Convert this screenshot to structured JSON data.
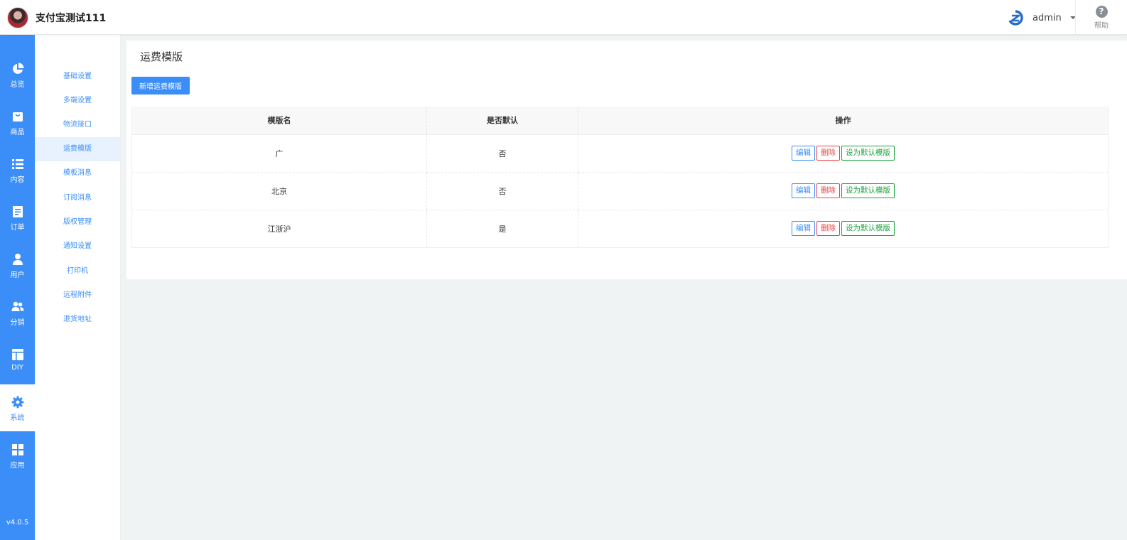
{
  "header": {
    "shop_name": "支付宝测试111",
    "username": "admin",
    "help_label": "帮助"
  },
  "iconbar": {
    "items": [
      {
        "label": "总览",
        "icon": "pie-chart-icon"
      },
      {
        "label": "商品",
        "icon": "shopping-bag-icon"
      },
      {
        "label": "内容",
        "icon": "list-icon"
      },
      {
        "label": "订单",
        "icon": "document-icon"
      },
      {
        "label": "用户",
        "icon": "user-icon"
      },
      {
        "label": "分销",
        "icon": "users-icon"
      },
      {
        "label": "DIY",
        "icon": "layout-icon"
      },
      {
        "label": "系统",
        "icon": "gear-icon"
      },
      {
        "label": "应用",
        "icon": "grid-icon"
      }
    ],
    "active": "系统",
    "version": "v4.0.5"
  },
  "submenu": {
    "items": [
      "基础设置",
      "多端设置",
      "物流接口",
      "运费模版",
      "模板消息",
      "订阅消息",
      "版权管理",
      "通知设置",
      "打印机",
      "远程附件",
      "退货地址"
    ],
    "active": "运费模版"
  },
  "main": {
    "title": "运费模版",
    "add_button": "新增运费模版",
    "columns": [
      "模版名",
      "是否默认",
      "操作"
    ],
    "rows": [
      {
        "name": "广",
        "is_default": "否"
      },
      {
        "name": "北京",
        "is_default": "否"
      },
      {
        "name": "江浙沪",
        "is_default": "是"
      }
    ],
    "actions": {
      "edit": "编辑",
      "delete": "删除",
      "set_default": "设为默认模版"
    }
  },
  "colors": {
    "accent": "#3b8ef8",
    "danger": "#ed4040",
    "success": "#19a33b"
  }
}
